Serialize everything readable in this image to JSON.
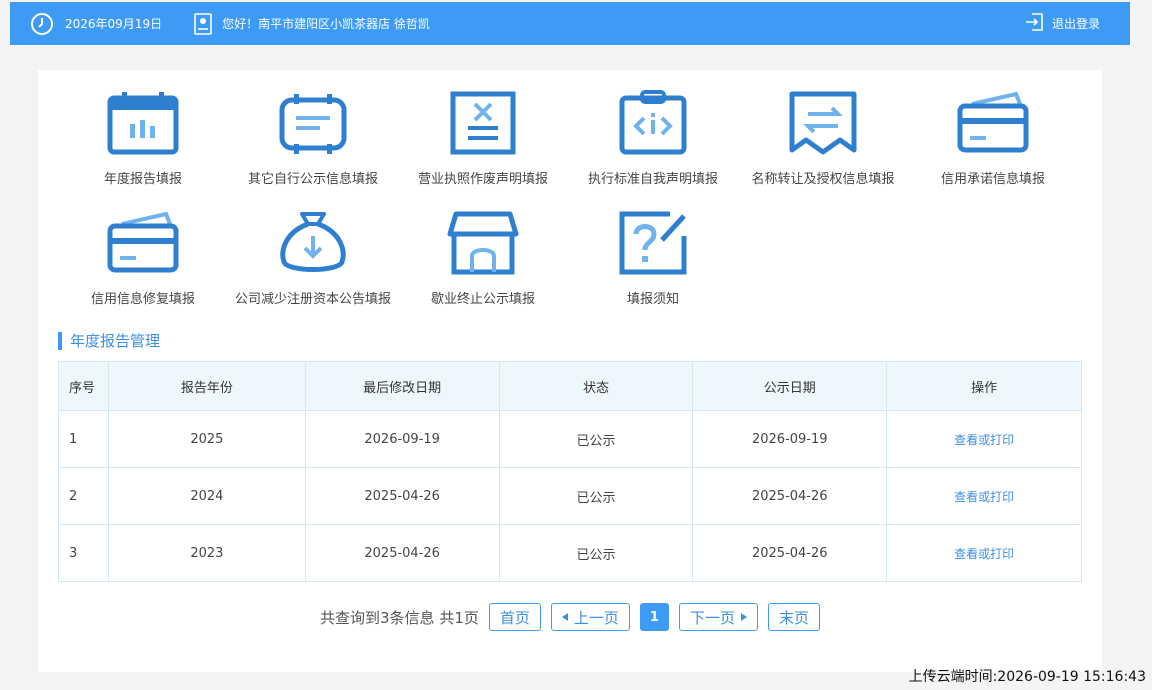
{
  "header": {
    "date": "2026年09月19日",
    "greeting": "您好！南平市建阳区小凯茶器店 徐哲凯",
    "logout_label": "退出登录",
    "bg_color": "#3d9bf5"
  },
  "tiles": [
    {
      "label": "年度报告填报",
      "icon": "calendar-chart-icon"
    },
    {
      "label": "其它自行公示信息填报",
      "icon": "document-lines-icon"
    },
    {
      "label": "营业执照作废声明填报",
      "icon": "license-cancel-icon"
    },
    {
      "label": "执行标准自我声明填报",
      "icon": "clipboard-code-icon"
    },
    {
      "label": "名称转让及授权信息填报",
      "icon": "transfer-arrows-icon"
    },
    {
      "label": "信用承诺信息填报",
      "icon": "credit-card-icon"
    },
    {
      "label": "信用信息修复填报",
      "icon": "credit-card-repair-icon"
    },
    {
      "label": "公司减少注册资本公告填报",
      "icon": "money-bag-down-icon"
    },
    {
      "label": "歇业终止公示填报",
      "icon": "store-icon"
    },
    {
      "label": "填报须知",
      "icon": "question-edit-icon"
    }
  ],
  "section": {
    "title": "年度报告管理"
  },
  "table": {
    "headers": [
      "序号",
      "报告年份",
      "最后修改日期",
      "状态",
      "公示日期",
      "操作"
    ],
    "rows": [
      {
        "index": "1",
        "year": "2025",
        "modified": "2026-09-19",
        "status": "已公示",
        "published": "2026-09-19",
        "action": "查看或打印"
      },
      {
        "index": "2",
        "year": "2024",
        "modified": "2025-04-26",
        "status": "已公示",
        "published": "2025-04-26",
        "action": "查看或打印"
      },
      {
        "index": "3",
        "year": "2023",
        "modified": "2025-04-26",
        "status": "已公示",
        "published": "2025-04-26",
        "action": "查看或打印"
      }
    ]
  },
  "pager": {
    "info": "共查询到3条信息 共1页",
    "first": "首页",
    "prev": "上一页",
    "current": "1",
    "next": "下一页",
    "last": "末页"
  },
  "footer": {
    "upload_time": "上传云端时间:2026-09-19 15:16:43"
  }
}
